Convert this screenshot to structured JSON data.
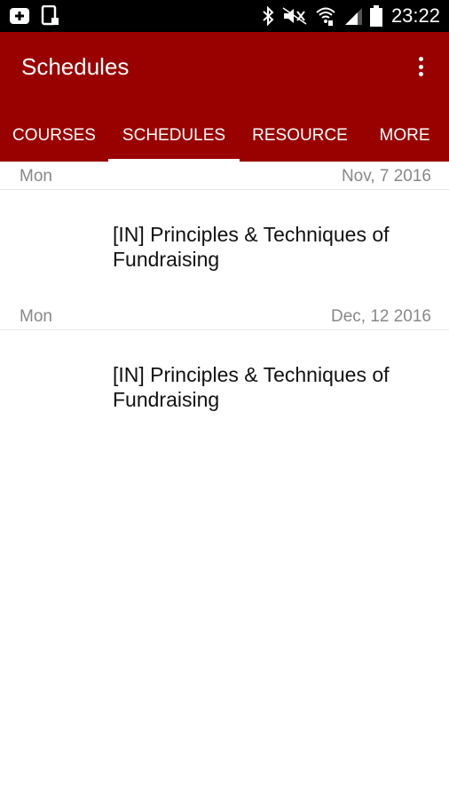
{
  "status_bar": {
    "time": "23:22",
    "icons": [
      "screen-mirror-icon",
      "cast-icon",
      "bluetooth-icon",
      "mute-icon",
      "wifi-icon",
      "signal-icon",
      "battery-icon"
    ]
  },
  "app_bar": {
    "title": "Schedules",
    "overflow_icon": "more-vert-icon",
    "background_color": "#990000"
  },
  "tabs": [
    {
      "label": "COURSES",
      "selected": false
    },
    {
      "label": "SCHEDULES",
      "selected": true
    },
    {
      "label": "RESOURCE",
      "selected": false
    },
    {
      "label": "MORE",
      "selected": false
    }
  ],
  "schedule": [
    {
      "day": "Mon",
      "date": "Nov, 7 2016",
      "events": [
        {
          "title": "[IN] Principles & Techniques of Fundraising"
        }
      ]
    },
    {
      "day": "Mon",
      "date": "Dec, 12 2016",
      "events": [
        {
          "title": "[IN] Principles & Techniques of Fundraising"
        }
      ]
    }
  ]
}
